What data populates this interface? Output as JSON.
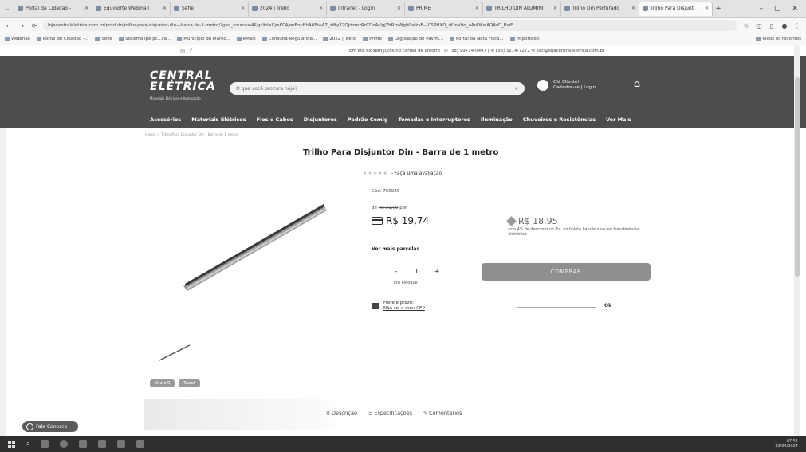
{
  "browser": {
    "tabs": [
      {
        "label": "Portal da Cidadão -",
        "active": false
      },
      {
        "label": "Equinorte Webmail",
        "active": false
      },
      {
        "label": "Sefie",
        "active": false
      },
      {
        "label": "2024 | Trello",
        "active": false
      },
      {
        "label": "Intranet - Login",
        "active": false
      },
      {
        "label": "PRIME",
        "active": false
      },
      {
        "label": "TRILHO DIN ALUMÍNI",
        "active": false
      },
      {
        "label": "Trilho Din Perfurado",
        "active": false
      },
      {
        "label": "Trilho Para Disjunt",
        "active": true
      }
    ],
    "url": "lojacentraleletrica.com.br/produto/trilho-para-disjuntor-din---barra-de-1-metro/?gad_source=4&gclid=CjwKCAjwrEovBhA6EiwA7_slfty72QjdzrezRrCDoAclgjYhRtoWgbQwkyF---CSPHXD_zKmVdq_oAoDKwAQAvD_BwE",
    "bookmarks": [
      "Webmail",
      "Portal do Cidadão -...",
      "Sefie",
      "Sistema Ipê pc...Fa...",
      "Município de Marec...",
      "eMais",
      "Consulta Regularida...",
      "2022 | Trello",
      "Prime",
      "Legislação de Pavim...",
      "Portal da Nota Fisca...",
      "Importado"
    ],
    "bookmarks_right": "Todos os favoritos"
  },
  "site": {
    "top_info": "Em até 6x sem juros no cartão de crédito | ✆ (38) 99734-0497 | ✆ (38) 3214-7272  ✉ sac@lojacentraleletrica.com.br",
    "logo_line1": "CENTRAL",
    "logo_line2": "ELÉTRICA",
    "logo_tag": "Materiais Elétricos e Iluminação",
    "search_placeholder": "O que você procura hoje?",
    "account_greeting": "Olá Cliente!",
    "account_links": "Cadastre-se | Login",
    "categories": [
      "Acessórios",
      "Materiais Elétricos",
      "Fios e Cabos",
      "Disjuntores",
      "Padrão Cemig",
      "Tomadas e Interruptores",
      "Iluminação",
      "Chuveiros e Resistências",
      "Ver Mais"
    ],
    "breadcrumb": "Home  >  Trilho Para Disjuntor Din - Barra de 1 metro"
  },
  "product": {
    "title": "Trilho Para Disjuntor Din - Barra de 1 metro",
    "rating_text": "- Faça uma avaliação",
    "sku": "Cód: 760989",
    "old_price_prefix": "de",
    "old_price": "R$ 21,00",
    "old_price_suffix": "por",
    "price": "R$ 19,74",
    "pix_price": "R$ 18,95",
    "pix_note": "com 4% de desconto no Pix, no boleto bancário ou em transferência eletrônica",
    "more_installments": "Ver mais parcelas",
    "quantity": "1",
    "minus": "-",
    "plus": "+",
    "stock": "Em estoque",
    "buy_label": "COMPRAR",
    "freight_line1": "Frete e prazo:",
    "freight_line2": "Não sei o meu CEP",
    "ok_label": "Ok",
    "share_label": "Share 0",
    "tweet_label": "Tweet",
    "tab_description": "Descrição",
    "tab_specs": "Especificações",
    "tab_comments": "Comentários"
  },
  "whatsapp_label": "Fale Conosco",
  "taskbar": {
    "time": "07:51",
    "date": "12/04/2024"
  }
}
